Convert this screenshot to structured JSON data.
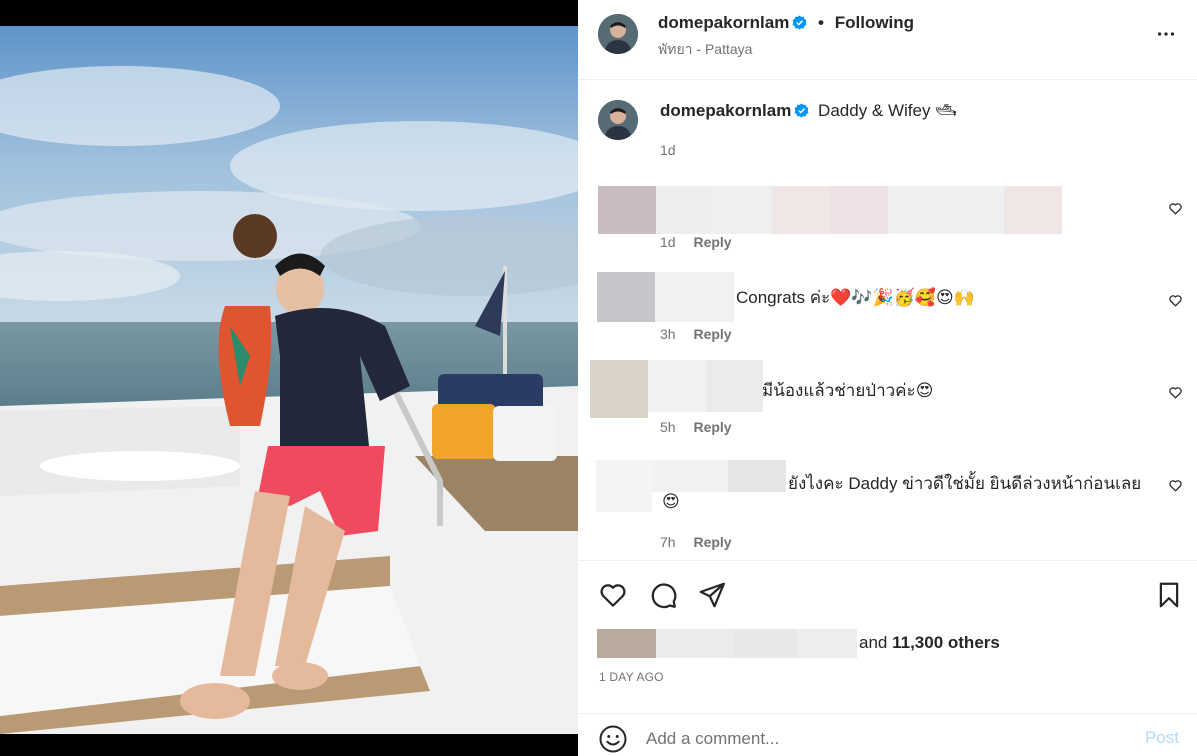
{
  "header": {
    "username": "domepakornlam",
    "separator": "•",
    "follow_status": "Following",
    "location": "พัทยา - Pattaya",
    "more_icon": "more-horizontal-icon"
  },
  "caption": {
    "username": "domepakornlam",
    "text": "Daddy & Wifey 🛥",
    "time": "1d"
  },
  "comments": [
    {
      "text": "",
      "time": "1d",
      "reply": "Reply"
    },
    {
      "text": "Congrats ค่ะ❤️🎶🎉🥳🥰😍🙌",
      "time": "3h",
      "reply": "Reply"
    },
    {
      "text": "มีน้องแล้วช่ายป่าวค่ะ😍",
      "time": "5h",
      "reply": "Reply"
    },
    {
      "text": "ยังไงคะ Daddy ข่าวดีใช่มั้ย ยินดีล่วงหน้าก่อนเลย",
      "text2": "😍",
      "time": "7h",
      "reply": "Reply"
    }
  ],
  "likes": {
    "prefix": "and",
    "count": "11,300 others"
  },
  "time_ago": "1 DAY AGO",
  "add_comment": {
    "placeholder": "Add a comment...",
    "post_label": "Post"
  },
  "colors": {
    "verified": "#0095f6",
    "post_disabled": "#b3dbff",
    "muted_text": "#737373"
  }
}
